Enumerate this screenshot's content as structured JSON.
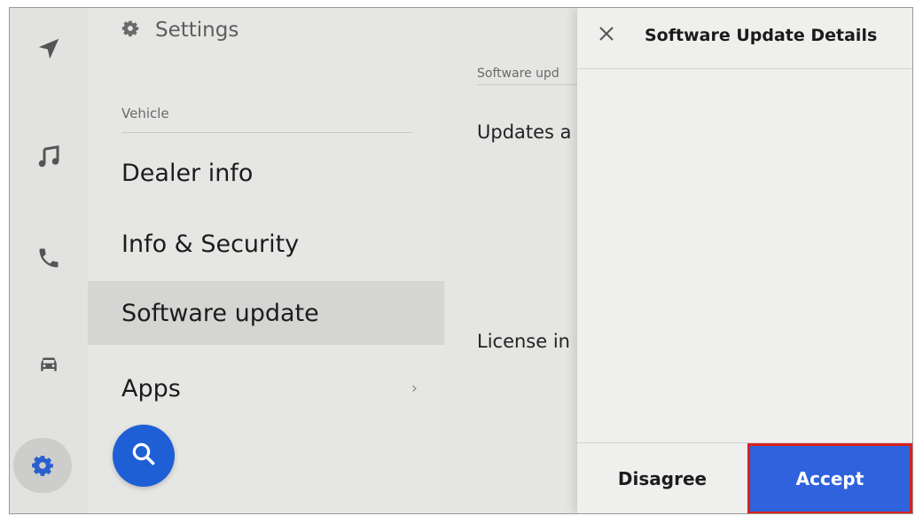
{
  "rail": {
    "items": [
      {
        "icon": "navigation-icon"
      },
      {
        "icon": "music-icon"
      },
      {
        "icon": "phone-icon"
      },
      {
        "icon": "car-icon"
      },
      {
        "icon": "gear-icon",
        "active": true
      }
    ]
  },
  "settings": {
    "title": "Settings",
    "section_label": "Vehicle",
    "items": [
      {
        "label": "Dealer info"
      },
      {
        "label": "Info & Security"
      },
      {
        "label": "Software update",
        "selected": true
      },
      {
        "label": "Apps",
        "chevron": "›"
      }
    ],
    "search_icon": "search-icon"
  },
  "content": {
    "breadcrumb": "Software upd",
    "row_updates": "Updates a",
    "row_license": "License in"
  },
  "dialog": {
    "title": "Software Update Details",
    "disagree_label": "Disagree",
    "accept_label": "Accept"
  },
  "colors": {
    "accent_blue": "#2f62dc",
    "fab_blue": "#1f5fd6",
    "highlight_red": "#d9201e",
    "active_icon_blue": "#2a5fcf"
  }
}
